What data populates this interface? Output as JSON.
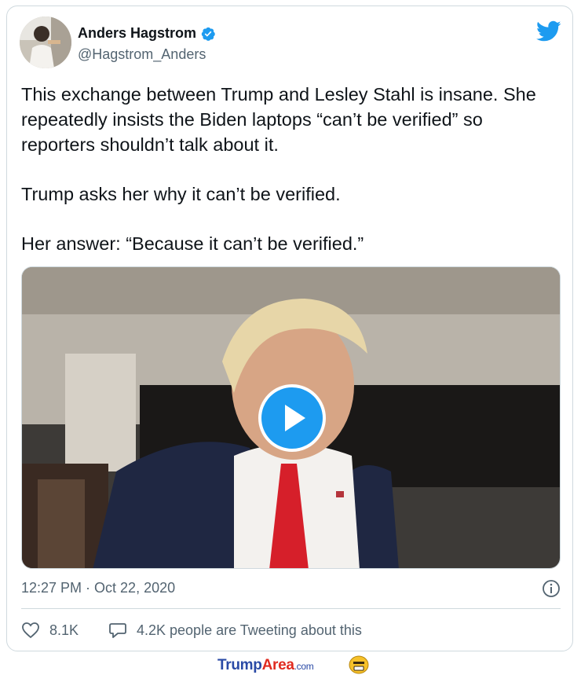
{
  "tweet": {
    "author_name": "Anders Hagstrom",
    "author_handle": "@Hagstrom_Anders",
    "text_lines": [
      "This exchange between Trump and Lesley Stahl is insane. She",
      "repeatedly insists the Biden laptops “can’t be verified” so",
      "reporters shouldn’t talk about it.",
      "Trump asks her why it can’t be verified.",
      "Her answer: “Because it can’t be verified.”"
    ],
    "timestamp": "12:27 PM · Oct 22, 2020",
    "likes": "8.1K",
    "conversation": "4.2K people are Tweeting about this"
  },
  "icons": {
    "verified": "verified-badge-icon",
    "logo": "twitter-bird-icon",
    "play": "play-icon",
    "info": "info-icon",
    "like": "heart-icon",
    "reply": "speech-bubble-icon"
  },
  "colors": {
    "accent": "#1d9bf0",
    "text": "#0f1419",
    "muted": "#536471",
    "border": "#cfd9de"
  },
  "watermark": {
    "part1": "Trump",
    "part2": "Area",
    "part3": ".com"
  }
}
